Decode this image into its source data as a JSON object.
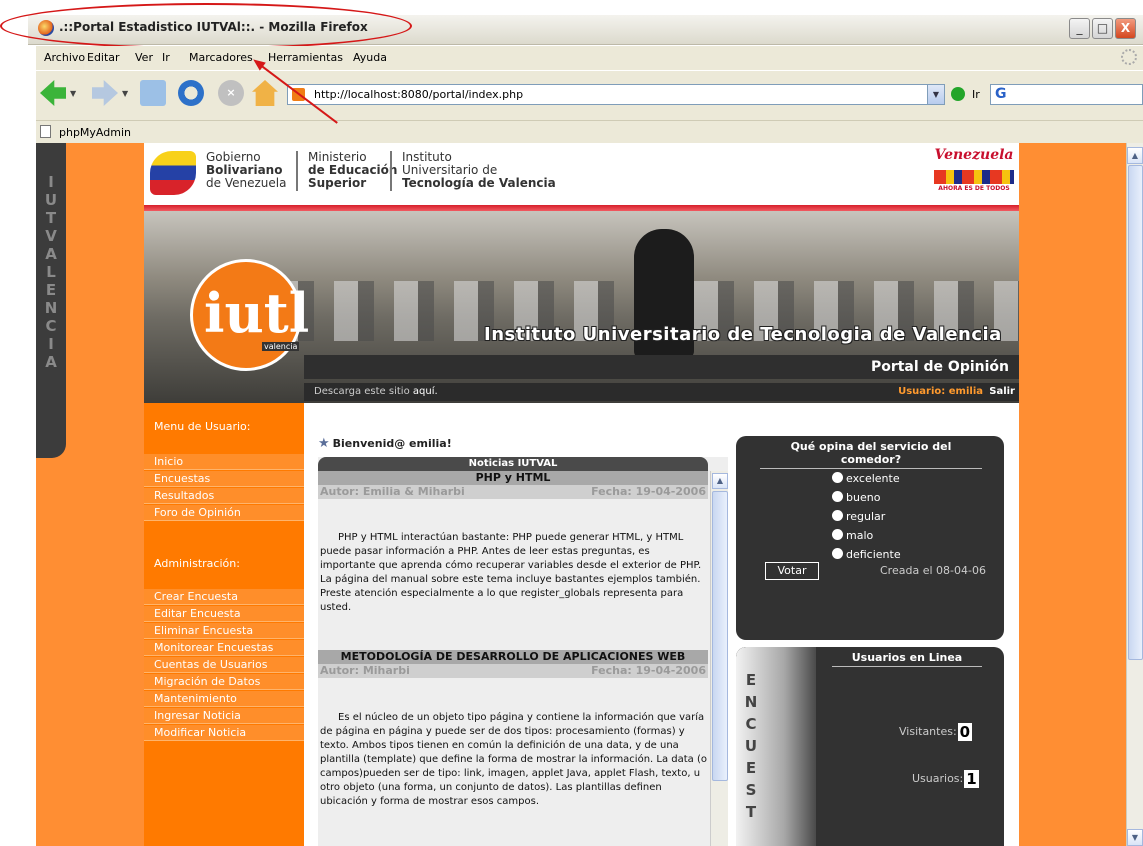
{
  "window": {
    "title": ".::Portal Estadistico IUTVAl::. - Mozilla Firefox",
    "controls": {
      "minimize": "_",
      "maximize": "□",
      "close": "X"
    }
  },
  "menubar": [
    "Archivo",
    "Editar",
    "Ver",
    "Ir",
    "Marcadores",
    "Herramientas",
    "Ayuda"
  ],
  "navbar": {
    "url": "http://localhost:8080/portal/index.php",
    "go_label": "Ir",
    "search_engine": "G"
  },
  "bookmarks": [
    {
      "label": "phpMyAdmin"
    }
  ],
  "annotation_color": "#d51818",
  "sidetab_letters": [
    "I",
    "U",
    "T",
    "V",
    "A",
    "L",
    "E",
    "N",
    "C",
    "I",
    "A"
  ],
  "gov_header": {
    "block1": [
      "Gobierno",
      "Bolivariano",
      "de Venezuela"
    ],
    "block2": [
      "Ministerio",
      "de Educación",
      "Superior"
    ],
    "block3": [
      "Instituto",
      "Universitario de",
      "Tecnología de Valencia"
    ],
    "brand": "Venezuela",
    "brand_tag": "AHORA ES DE TODOS"
  },
  "banner": {
    "title": "Instituto Universitario de Tecnologia de Valencia",
    "logo": "iutl",
    "logo_sub": "valencia",
    "portal_title": "Portal de Opinión"
  },
  "subbar": {
    "download_text": "Descarga este sitio",
    "download_link": "aquí.",
    "user": "Usuario: emilia",
    "logout": "Salir"
  },
  "leftmenu": {
    "user_heading": "Menu de Usuario:",
    "user_links": [
      "Inicio",
      "Encuestas",
      "Resultados",
      "Foro de Opinión"
    ],
    "admin_heading": "Administración:",
    "admin_links": [
      "Crear Encuesta",
      "Editar Encuesta",
      "Eliminar Encuesta",
      "Monitorear Encuestas",
      "Cuentas de Usuarios",
      "Migración de Datos",
      "Mantenimiento",
      "Ingresar Noticia",
      "Modificar Noticia"
    ]
  },
  "welcome": "Bienvenid@ emilia!",
  "news": {
    "heading": "Noticias IUTVAL",
    "articles": [
      {
        "title": "PHP y HTML",
        "author": "Autor: Emilia & Miharbi",
        "date": "Fecha: 19-04-2006",
        "body": "PHP y HTML interactúan bastante: PHP puede generar HTML, y HTML puede pasar información a PHP. Antes de leer estas preguntas, es importante que aprenda cómo recuperar variables desde el exterior de PHP. La página del manual sobre este tema incluye bastantes ejemplos también. Preste atención especialmente a lo que register_globals representa para usted."
      },
      {
        "title": "METODOLOGÍA DE DESARROLLO DE APLICACIONES WEB",
        "author": "Autor: Miharbi",
        "date": "Fecha: 19-04-2006",
        "body": "Es el núcleo de un objeto tipo página y contiene la información que varía de página en página y puede ser de dos tipos: procesamiento (formas) y texto. Ambos tipos tienen en común la definición de una data, y de una plantilla (template) que define la forma de mostrar la información. La data (o campos)pueden ser de tipo: link, imagen, applet Java, applet Flash, texto, u otro objeto (una forma, un conjunto de datos). Las plantillas definen ubicación y forma de mostrar esos campos."
      }
    ]
  },
  "poll": {
    "question": "Qué opina del servicio del comedor?",
    "options": [
      "excelente",
      "bueno",
      "regular",
      "malo",
      "deficiente"
    ],
    "vote_label": "Votar",
    "created": "Creada el 08-04-06"
  },
  "online": {
    "heading": "Usuarios en Linea",
    "side_letters": [
      "E",
      "N",
      "C",
      "U",
      "E",
      "S",
      "T"
    ],
    "visitors_label": "Visitantes:",
    "visitors": "0",
    "users_label": "Usuarios:",
    "users": "1"
  }
}
